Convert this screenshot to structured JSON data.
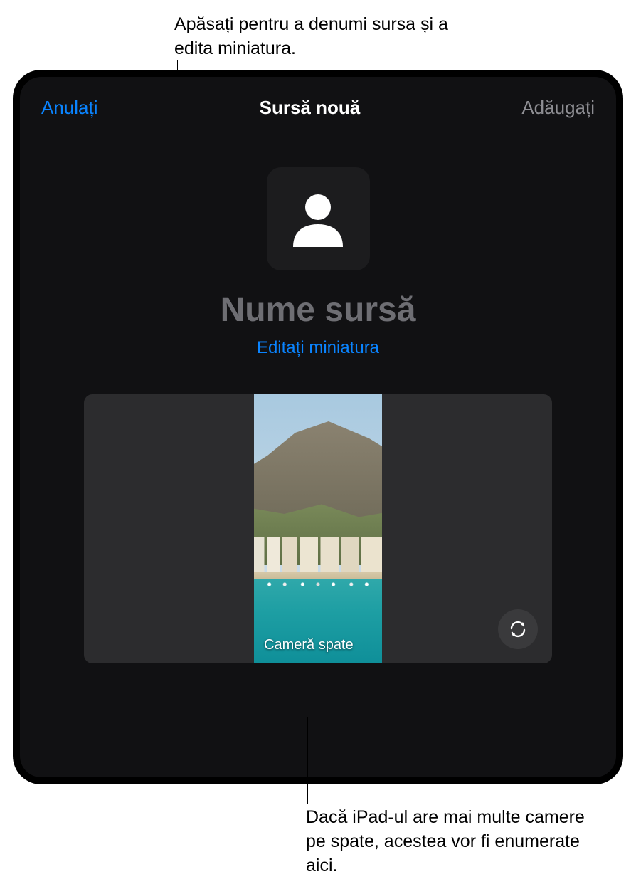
{
  "callouts": {
    "top": "Apăsați pentru a denumi sursa și a edita miniatura.",
    "bottom": "Dacă iPad-ul are mai multe camere pe spate, acestea vor fi enumerate aici."
  },
  "header": {
    "cancel": "Anulați",
    "title": "Sursă nouă",
    "add": "Adăugați"
  },
  "source": {
    "name_placeholder": "Nume sursă",
    "edit_thumbnail": "Editați miniatura"
  },
  "preview": {
    "camera_label": "Cameră spate"
  }
}
